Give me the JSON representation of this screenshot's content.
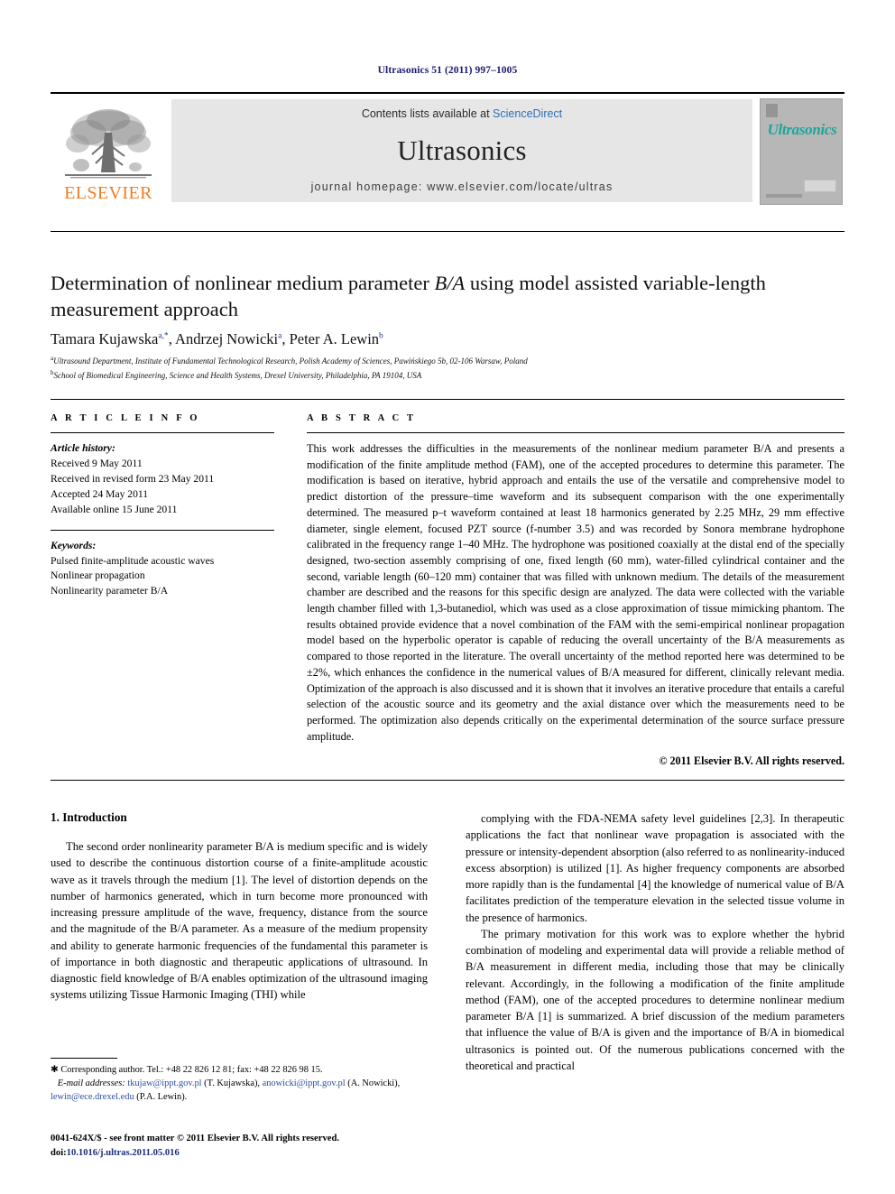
{
  "running_head": "Ultrasonics 51 (2011) 997–1005",
  "masthead": {
    "publisher_name": "ELSEVIER",
    "contents_prefix": "Contents lists available at ",
    "contents_link": "ScienceDirect",
    "journal_name": "Ultrasonics",
    "homepage": "journal homepage: www.elsevier.com/locate/ultras",
    "cover_title": "Ultrasonics",
    "logo_icon": "elsevier-tree-logo"
  },
  "article": {
    "title_line1_a": "Determination of nonlinear medium parameter ",
    "title_line1_b": "B/A",
    "title_line1_c": " using model assisted",
    "title_line2": "variable-length measurement approach",
    "authors": [
      {
        "name": "Tamara Kujawska",
        "sup": "a,*"
      },
      {
        "name": "Andrzej Nowicki",
        "sup": "a"
      },
      {
        "name": "Peter A. Lewin",
        "sup": "b"
      }
    ],
    "affiliations": [
      {
        "mark": "a",
        "text": "Ultrasound Department, Institute of Fundamental Technological Research, Polish Academy of Sciences, Pawińskiego 5b, 02-106 Warsaw, Poland"
      },
      {
        "mark": "b",
        "text": "School of Biomedical Engineering, Science and Health Systems, Drexel University, Philadelphia, PA 19104, USA"
      }
    ]
  },
  "article_info": {
    "heading": "A R T I C L E    I N F O",
    "history_label": "Article history:",
    "history": [
      "Received 9 May 2011",
      "Received in revised form 23 May 2011",
      "Accepted 24 May 2011",
      "Available online 15 June 2011"
    ],
    "keywords_label": "Keywords:",
    "keywords": [
      "Pulsed finite-amplitude acoustic waves",
      "Nonlinear propagation",
      "Nonlinearity parameter B/A"
    ]
  },
  "abstract": {
    "heading": "A B S T R A C T",
    "text": "This work addresses the difficulties in the measurements of the nonlinear medium parameter B/A and presents a modification of the finite amplitude method (FAM), one of the accepted procedures to determine this parameter. The modification is based on iterative, hybrid approach and entails the use of the versatile and comprehensive model to predict distortion of the pressure–time waveform and its subsequent comparison with the one experimentally determined. The measured p–t waveform contained at least 18 harmonics generated by 2.25 MHz, 29 mm effective diameter, single element, focused PZT source (f-number 3.5) and was recorded by Sonora membrane hydrophone calibrated in the frequency range 1–40 MHz. The hydrophone was positioned coaxially at the distal end of the specially designed, two-section assembly comprising of one, fixed length (60 mm), water-filled cylindrical container and the second, variable length (60–120 mm) container that was filled with unknown medium. The details of the measurement chamber are described and the reasons for this specific design are analyzed. The data were collected with the variable length chamber filled with 1,3-butanediol, which was used as a close approximation of tissue mimicking phantom. The results obtained provide evidence that a novel combination of the FAM with the semi-empirical nonlinear propagation model based on the hyperbolic operator is capable of reducing the overall uncertainty of the B/A measurements as compared to those reported in the literature. The overall uncertainty of the method reported here was determined to be ±2%, which enhances the confidence in the numerical values of B/A measured for different, clinically relevant media. Optimization of the approach is also discussed and it is shown that it involves an iterative procedure that entails a careful selection of the acoustic source and its geometry and the axial distance over which the measurements need to be performed. The optimization also depends critically on the experimental determination of the source surface pressure amplitude.",
    "copyright": "© 2011 Elsevier B.V. All rights reserved."
  },
  "body": {
    "section_number_title": "1. Introduction",
    "left_paragraph": "The second order nonlinearity parameter B/A is medium specific and is widely used to describe the continuous distortion course of a finite-amplitude acoustic wave as it travels through the medium [1]. The level of distortion depends on the number of harmonics generated, which in turn become more pronounced with increasing pressure amplitude of the wave, frequency, distance from the source and the magnitude of the B/A parameter. As a measure of the medium propensity and ability to generate harmonic frequencies of the fundamental this parameter is of importance in both diagnostic and therapeutic applications of ultrasound. In diagnostic field knowledge of B/A enables optimization of the ultrasound imaging systems utilizing Tissue Harmonic Imaging (THI) while",
    "right_paragraph_1": "complying with the FDA-NEMA safety level guidelines [2,3]. In therapeutic applications the fact that nonlinear wave propagation is associated with the pressure or intensity-dependent absorption (also referred to as nonlinearity-induced excess absorption) is utilized [1]. As higher frequency components are absorbed more rapidly than is the fundamental [4] the knowledge of numerical value of B/A facilitates prediction of the temperature elevation in the selected tissue volume in the presence of harmonics.",
    "right_paragraph_2": "The primary motivation for this work was to explore whether the hybrid combination of modeling and experimental data will provide a reliable method of B/A measurement in different media, including those that may be clinically relevant. Accordingly, in the following a modification of the finite amplitude method (FAM), one of the accepted procedures to determine nonlinear medium parameter B/A [1] is summarized. A brief discussion of the medium parameters that influence the value of B/A is given and the importance of B/A in biomedical ultrasonics is pointed out. Of the numerous publications concerned with the theoretical and practical"
  },
  "footnotes": {
    "corresponding": "Corresponding author. Tel.: +48 22 826 12 81; fax: +48 22 826 98 15.",
    "email_label": "E-mail addresses:",
    "emails": [
      {
        "address": "tkujaw@ippt.gov.pl",
        "owner": "(T. Kujawska),"
      },
      {
        "address": "anowicki@ippt.gov.pl",
        "owner": "(A. Nowicki),"
      },
      {
        "address": "lewin@ece.drexel.edu",
        "owner": "(P.A. Lewin)."
      }
    ]
  },
  "imprint": {
    "issn_line": "0041-624X/$ - see front matter © 2011 Elsevier B.V. All rights reserved.",
    "doi_label": "doi:",
    "doi_value": "10.1016/j.ultras.2011.05.016"
  },
  "colors": {
    "elsevier_orange": "#ef7d22",
    "link_blue": "#2f6fb5",
    "ref_blue": "#1a3a8f",
    "cover_teal": "#19a89b",
    "band_grey": "#e6e6e6"
  }
}
